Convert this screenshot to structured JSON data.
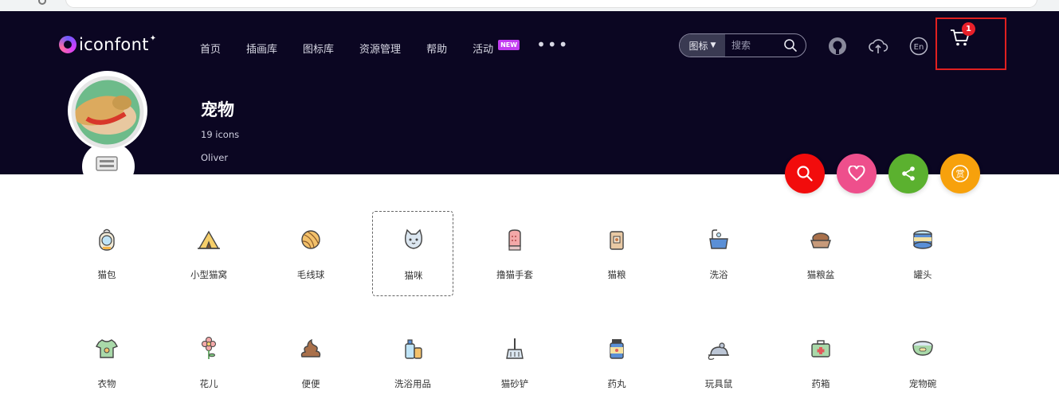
{
  "header": {
    "logo_text": "iconfont",
    "nav": [
      {
        "label": "首页"
      },
      {
        "label": "插画库"
      },
      {
        "label": "图标库"
      },
      {
        "label": "资源管理"
      },
      {
        "label": "帮助"
      },
      {
        "label": "活动",
        "badge": "NEW"
      }
    ],
    "more_label": "•••",
    "search": {
      "type_label": "图标",
      "placeholder": "搜索"
    },
    "cart_count": "1"
  },
  "profile": {
    "title": "宠物",
    "count": "19 icons",
    "author": "Oliver"
  },
  "icons": [
    {
      "label": "猫包",
      "icon": "cat-backpack-icon"
    },
    {
      "label": "小型猫窝",
      "icon": "cat-tent-icon"
    },
    {
      "label": "毛线球",
      "icon": "yarn-ball-icon"
    },
    {
      "label": "猫咪",
      "icon": "cat-face-icon",
      "selected": true
    },
    {
      "label": "撸猫手套",
      "icon": "grooming-glove-icon"
    },
    {
      "label": "猫粮",
      "icon": "cat-food-bag-icon"
    },
    {
      "label": "洗浴",
      "icon": "bath-tub-icon"
    },
    {
      "label": "猫粮盆",
      "icon": "food-bowl-icon"
    },
    {
      "label": "罐头",
      "icon": "can-icon"
    },
    {
      "label": "衣物",
      "icon": "pet-shirt-icon"
    },
    {
      "label": "花儿",
      "icon": "flower-icon"
    },
    {
      "label": "便便",
      "icon": "poop-icon"
    },
    {
      "label": "洗浴用品",
      "icon": "bath-supplies-icon"
    },
    {
      "label": "猫砂铲",
      "icon": "litter-scoop-icon"
    },
    {
      "label": "药丸",
      "icon": "pill-bottle-icon"
    },
    {
      "label": "玩具鼠",
      "icon": "toy-mouse-icon"
    },
    {
      "label": "药箱",
      "icon": "medicine-box-icon"
    },
    {
      "label": "宠物碗",
      "icon": "pet-bowl-icon"
    }
  ],
  "colors": {
    "hero_bg": "#0b0622",
    "fab_search": "#f20c0c",
    "fab_like": "#ee4f8c",
    "fab_share": "#5bb12f",
    "fab_reward": "#f7a10c",
    "highlight": "#e02020"
  }
}
